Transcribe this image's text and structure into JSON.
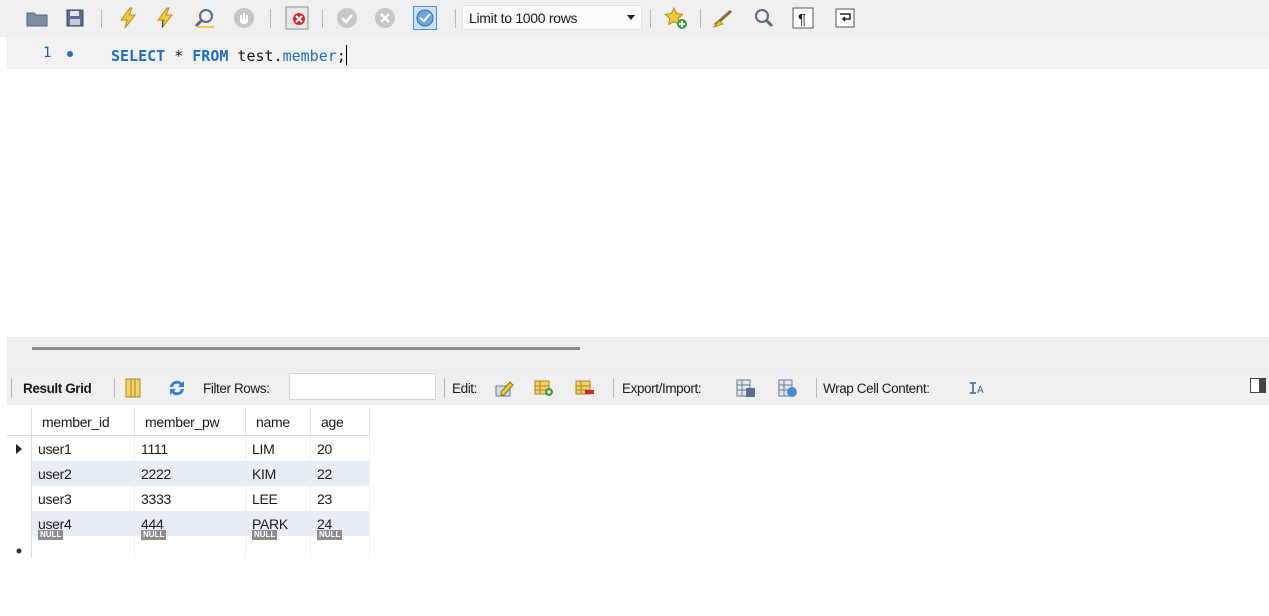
{
  "toolbar": {
    "icons": [
      "open-folder-icon",
      "save-icon",
      "execute-icon",
      "execute-current-icon",
      "explain-icon",
      "stop-icon",
      "toggle-error-icon",
      "commit-icon",
      "rollback-icon",
      "autocommit-icon",
      "add-snippet-icon",
      "beautify-icon",
      "find-icon",
      "invisible-chars-icon",
      "word-wrap-icon"
    ],
    "limit_label": "Limit to 1000 rows"
  },
  "editor": {
    "line_number": "1",
    "code": {
      "select": "SELECT",
      "star": " * ",
      "from": "FROM",
      "schema": " test.",
      "table": "member",
      "semicolon": ";"
    }
  },
  "results": {
    "result_grid_label": "Result Grid",
    "filter_label": "Filter Rows:",
    "filter_value": "",
    "edit_label": "Edit:",
    "export_label": "Export/Import:",
    "wrap_label": "Wrap Cell Content:",
    "columns": [
      "member_id",
      "member_pw",
      "name",
      "age"
    ],
    "rows": [
      [
        "user1",
        "1111",
        "LIM",
        "20"
      ],
      [
        "user2",
        "2222",
        "KIM",
        "22"
      ],
      [
        "user3",
        "3333",
        "LEE",
        "23"
      ],
      [
        "user4",
        "444",
        "PARK",
        "24"
      ]
    ],
    "null_label": "NULL"
  },
  "colors": {
    "keyword": "#1c6fbf",
    "row_alt": "#e8eef8",
    "toolbar_bg": "#f0f0f0"
  }
}
